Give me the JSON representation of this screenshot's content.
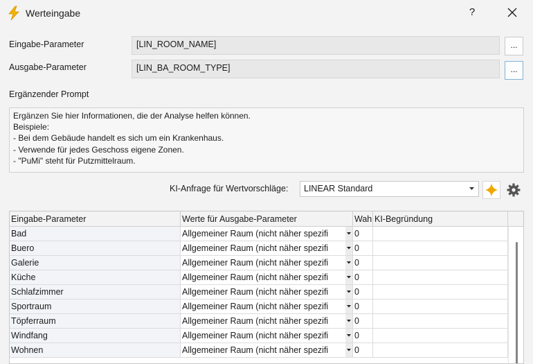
{
  "window": {
    "title": "Werteingabe",
    "help_label": "?"
  },
  "input_param": {
    "label": "Eingabe-Parameter",
    "value": "[LIN_ROOM_NAME]",
    "button": "..."
  },
  "output_param": {
    "label": "Ausgabe-Parameter",
    "value": "[LIN_BA_ROOM_TYPE]",
    "button": "..."
  },
  "prompt": {
    "label": "Ergänzender Prompt",
    "text": "Ergänzen Sie hier Informationen, die der Analyse helfen können.\nBeispiele:\n- Bei dem Gebäude handelt es sich um ein Krankenhaus.\n- Verwende für jedes Geschoss eigene Zonen.\n- \"PuMi\" steht für Putzmittelraum."
  },
  "ki_request": {
    "label": "KI-Anfrage für Wertvorschläge:",
    "selected": "LINEAR Standard"
  },
  "colors": {
    "accent": "#f5b400",
    "spark": "#f0a800",
    "bolt": "#f2b400"
  },
  "icons": {
    "app": "lightning-icon",
    "close": "close-icon",
    "spark": "sparkle-icon",
    "gear": "gear-icon",
    "dropdown": "chevron-down-icon"
  },
  "table": {
    "headers": [
      "Eingabe-Parameter",
      "Werte für Ausgabe-Parameter",
      "Wah",
      "KI-Begründung"
    ],
    "rows": [
      [
        "Bad",
        "Allgemeiner Raum (nicht näher spezifi",
        "0",
        ""
      ],
      [
        "Buero",
        "Allgemeiner Raum (nicht näher spezifi",
        "0",
        ""
      ],
      [
        "Galerie",
        "Allgemeiner Raum (nicht näher spezifi",
        "0",
        ""
      ],
      [
        "Küche",
        "Allgemeiner Raum (nicht näher spezifi",
        "0",
        ""
      ],
      [
        "Schlafzimmer",
        "Allgemeiner Raum (nicht näher spezifi",
        "0",
        ""
      ],
      [
        "Sportraum",
        "Allgemeiner Raum (nicht näher spezifi",
        "0",
        ""
      ],
      [
        "Töpferraum",
        "Allgemeiner Raum (nicht näher spezifi",
        "0",
        ""
      ],
      [
        "Windfang",
        "Allgemeiner Raum (nicht näher spezifi",
        "0",
        ""
      ],
      [
        "Wohnen",
        "Allgemeiner Raum (nicht näher spezifi",
        "0",
        ""
      ]
    ]
  }
}
